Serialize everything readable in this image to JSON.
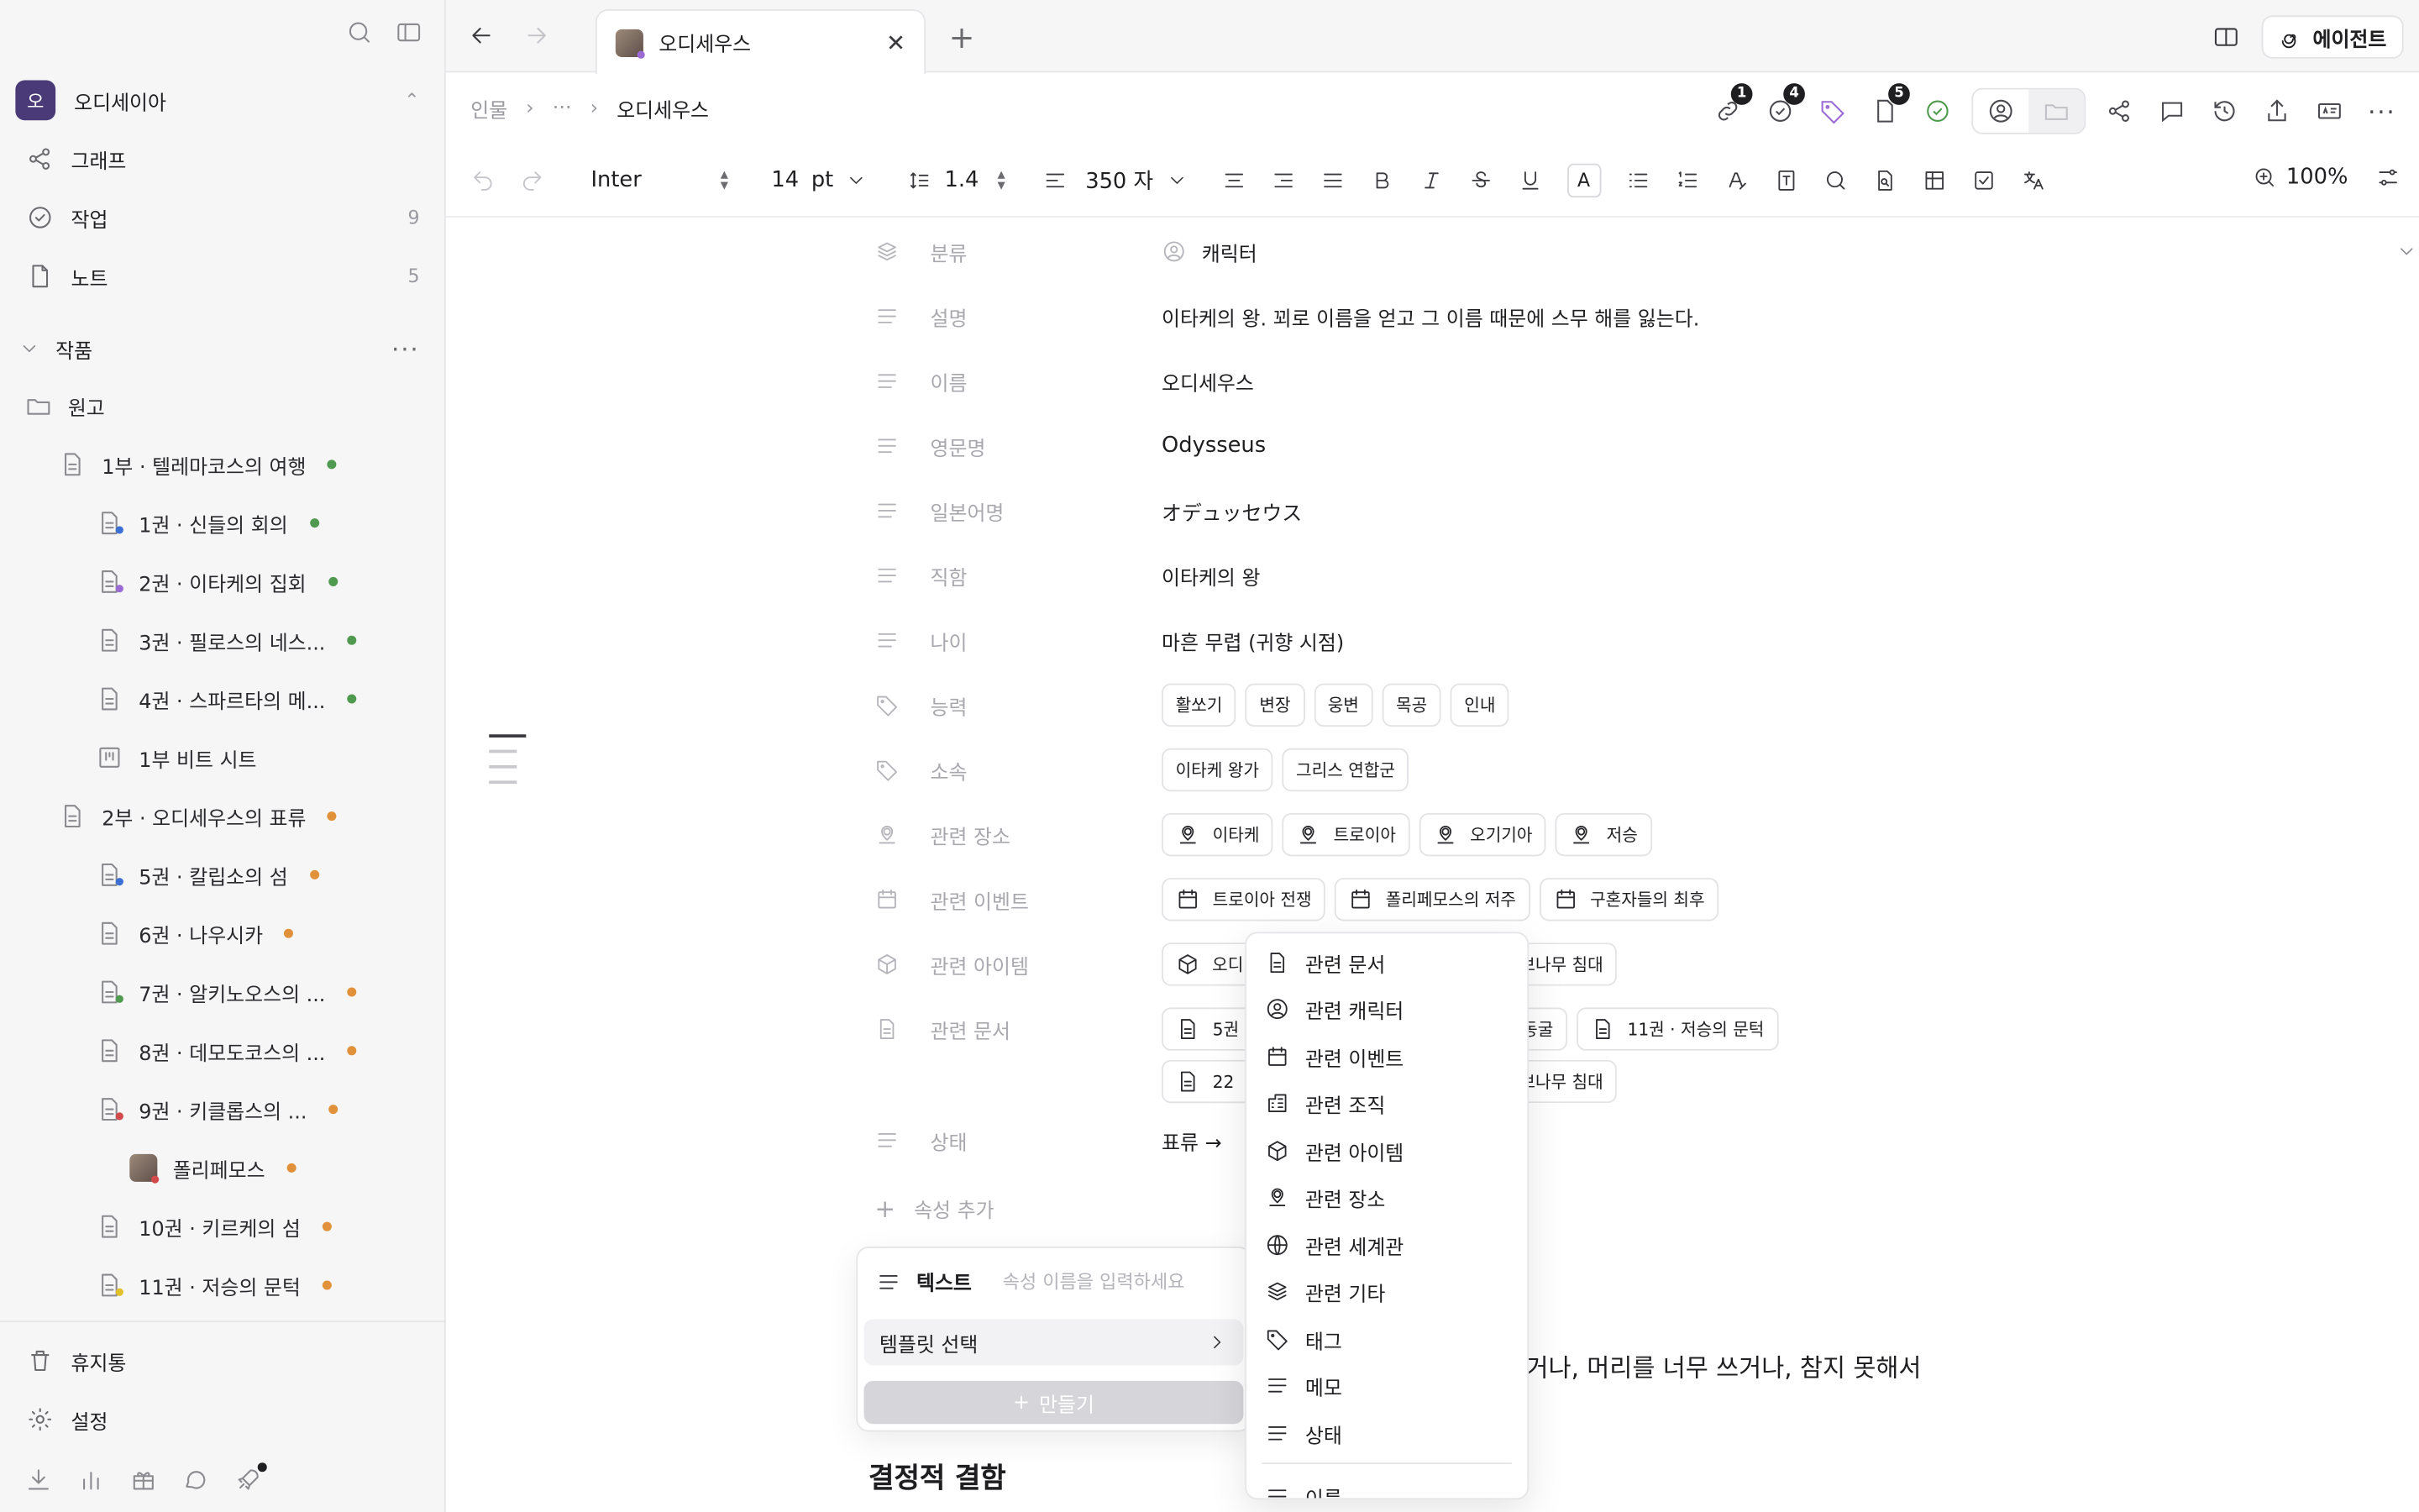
{
  "sidebar": {
    "workspace": {
      "initial": "오",
      "name": "오디세이아"
    },
    "nav": [
      {
        "label": "그래프",
        "count": ""
      },
      {
        "label": "작업",
        "count": "9"
      },
      {
        "label": "노트",
        "count": "5"
      }
    ],
    "section": {
      "label": "작품",
      "more": "···"
    },
    "tree": [
      {
        "label": "원고"
      },
      {
        "label": "1부 · 텔레마코스의 여행"
      },
      {
        "label": "1권 · 신들의 회의"
      },
      {
        "label": "2권 · 이타케의 집회"
      },
      {
        "label": "3권 · 필로스의 네스..."
      },
      {
        "label": "4권 · 스파르타의 메..."
      },
      {
        "label": "1부 비트 시트"
      },
      {
        "label": "2부 · 오디세우스의 표류"
      },
      {
        "label": "5권 · 칼립소의 섬"
      },
      {
        "label": "6권 · 나우시카"
      },
      {
        "label": "7권 · 알키노오스의 ..."
      },
      {
        "label": "8권 · 데모도코스의 ..."
      },
      {
        "label": "9권 · 키클롭스의 ..."
      },
      {
        "label": "폴리페모스"
      },
      {
        "label": "10권 · 키르케의 섬"
      },
      {
        "label": "11권 · 저승의 문턱"
      }
    ],
    "bottom": [
      {
        "label": "휴지통"
      },
      {
        "label": "설정"
      }
    ]
  },
  "tabs": {
    "active": "오디세우스",
    "agent_label": "에이전트"
  },
  "breadcrumb": {
    "root": "인물",
    "middle": "···",
    "current": "오디세우스",
    "badges": {
      "links": "1",
      "tasks": "4",
      "files": "5"
    }
  },
  "toolbar": {
    "font": "Inter",
    "size": "14",
    "size_unit": "pt",
    "line_height": "1.4",
    "width": "350 자",
    "zoom": "100%"
  },
  "props": {
    "category": {
      "name": "분류",
      "value": "캐릭터"
    },
    "description": {
      "name": "설명",
      "value": "이타케의 왕. 꾀로 이름을 얻고 그 이름 때문에 스무 해를 잃는다."
    },
    "name": {
      "name": "이름",
      "value": "오디세우스"
    },
    "english": {
      "name": "영문명",
      "value": "Odysseus"
    },
    "japanese": {
      "name": "일본어명",
      "value": "オデュッセウス"
    },
    "title": {
      "name": "직함",
      "value": "이타케의 왕"
    },
    "age": {
      "name": "나이",
      "value": "마흔 무렵 (귀향 시점)"
    },
    "abilities": {
      "name": "능력",
      "chips": [
        "활쏘기",
        "변장",
        "웅변",
        "목공",
        "인내"
      ]
    },
    "affiliation": {
      "name": "소속",
      "chips": [
        "이타케 왕가",
        "그리스 연합군"
      ]
    },
    "places": {
      "name": "관련 장소",
      "chips": [
        "이타케",
        "트로이아",
        "오기기아",
        "저승"
      ]
    },
    "events": {
      "name": "관련 이벤트",
      "chips": [
        "트로이아 전쟁",
        "폴리페모스의 저주",
        "구혼자들의 최후"
      ]
    },
    "items": {
      "name": "관련 아이템",
      "chips": [
        "오디",
        "리브나무 침대"
      ]
    },
    "docs": {
      "name": "관련 문서",
      "chips_row1": [
        "5권",
        "의 동굴",
        "11권 · 저승의 문턱"
      ],
      "chips_row2": [
        "22",
        "리브나무 침대"
      ]
    },
    "status": {
      "name": "상태",
      "value": "표류 →"
    },
    "add_label": "속성 추가"
  },
  "new_prop": {
    "type_label": "텍스트",
    "placeholder": "속성 이름을 입력하세요",
    "template_label": "템플릿 선택",
    "create_label": "만들기"
  },
  "dropdown": {
    "items": [
      "관련 문서",
      "관련 캐릭터",
      "관련 이벤트",
      "관련 조직",
      "관련 아이템",
      "관련 장소",
      "관련 세계관",
      "관련 기타",
      "태그",
      "메모",
      "상태",
      "이름"
    ]
  },
  "content": {
    "body_fragment": "거나, 머리를 너무 쓰거나, 참지 못해서",
    "heading": "결정적 결함"
  }
}
